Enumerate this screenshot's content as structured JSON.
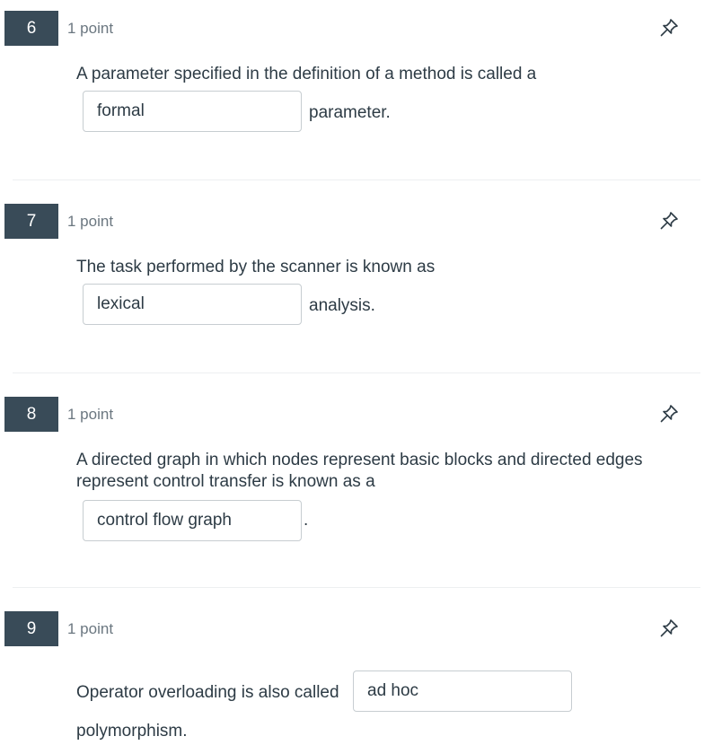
{
  "questions": [
    {
      "number": "6",
      "points": "1 point",
      "text": "A parameter specified in the definition of a method is called a",
      "answer": "formal",
      "after": "parameter."
    },
    {
      "number": "7",
      "points": "1 point",
      "text": "The task performed by the scanner is known as",
      "answer": "lexical",
      "after": "analysis."
    },
    {
      "number": "8",
      "points": "1 point",
      "text_line1": "A directed graph in which nodes represent basic blocks and directed edges",
      "text_line2": "represent control transfer is known as a",
      "answer": "control flow graph",
      "after": "."
    },
    {
      "number": "9",
      "points": "1 point",
      "text": "Operator overloading is also called",
      "answer": "ad hoc",
      "after": "polymorphism."
    }
  ],
  "icons": {
    "pin": "pin-icon"
  }
}
